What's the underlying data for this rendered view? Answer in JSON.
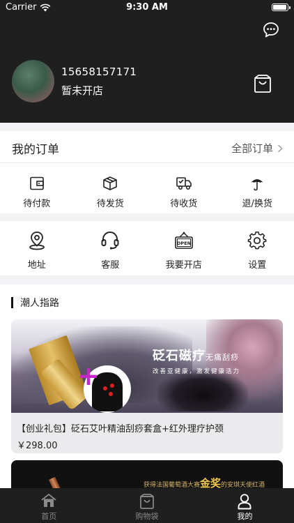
{
  "status_bar": {
    "carrier": "Carrier",
    "time": "9:30 AM",
    "battery_level": 0.95
  },
  "profile": {
    "phone": "15658157171",
    "shop_status": "暂未开店"
  },
  "orders": {
    "title": "我的订单",
    "all_label": "全部订单",
    "items": [
      {
        "label": "待付款",
        "icon": "wallet-icon"
      },
      {
        "label": "待发货",
        "icon": "package-icon"
      },
      {
        "label": "待收货",
        "icon": "delivery-truck-icon"
      },
      {
        "label": "退/换货",
        "icon": "umbrella-icon"
      }
    ]
  },
  "tools": {
    "items": [
      {
        "label": "地址",
        "icon": "location-pin-icon"
      },
      {
        "label": "客服",
        "icon": "headset-icon"
      },
      {
        "label": "我要开店",
        "icon": "open-sign-icon"
      },
      {
        "label": "设置",
        "icon": "gear-icon"
      }
    ]
  },
  "trend": {
    "title": "潮人指路",
    "products": [
      {
        "banner_title": "砭石磁疗",
        "banner_title_small": "无痛刮痧",
        "banner_sub": "改善亚健康，激发健康活力",
        "name": "【创业礼包】砭石艾叶精油刮痧套盒+红外理疗护颈",
        "price": "￥298.00"
      },
      {
        "banner_text_pre": "获得法国葡萄酒大赛",
        "banner_text_highlight": "金奖",
        "banner_text_post": "的安琪天使红酒"
      }
    ]
  },
  "tabbar": {
    "tabs": [
      {
        "label": "首页",
        "icon": "home-icon",
        "active": false
      },
      {
        "label": "购物袋",
        "icon": "shopping-bag-icon",
        "active": false
      },
      {
        "label": "我的",
        "icon": "user-icon",
        "active": true
      }
    ]
  },
  "colors": {
    "header_bg": "#1f1f1f",
    "page_bg": "#f3f3f5",
    "banner_plus": "#c227c7",
    "gold": "#f0c850"
  }
}
